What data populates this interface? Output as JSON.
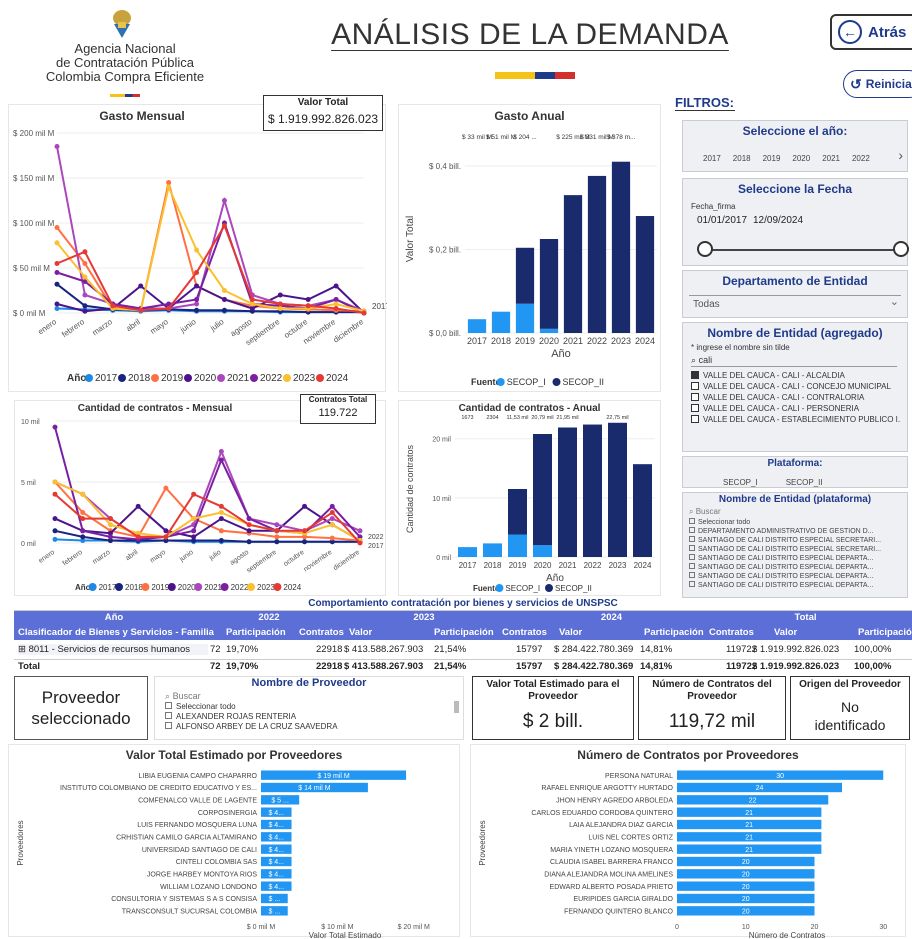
{
  "header": {
    "org_line1": "Agencia Nacional",
    "org_line2": "de Contratación Pública",
    "org_line3": "Colombia Compra Eficiente",
    "title": "ANÁLISIS DE LA DEMANDA",
    "back_label": "Atrás",
    "reset_label": "Reiniciar",
    "flag_colors": [
      "#f3c318",
      "#1f3a8a",
      "#d32f2f"
    ]
  },
  "filters": {
    "label": "FILTROS:",
    "year": {
      "title": "Seleccione el año:",
      "options": [
        "2017",
        "2018",
        "2019",
        "2020",
        "2021",
        "2022"
      ]
    },
    "date": {
      "title": "Seleccione la Fecha",
      "field": "Fecha_firma",
      "start": "01/01/2017",
      "end": "12/09/2024"
    },
    "department": {
      "title": "Departamento de Entidad",
      "value": "Todas"
    },
    "entity": {
      "title": "Nombre de Entidad (agregado)",
      "hint": "* ingrese el nombre sin tilde",
      "search": "cali",
      "items": [
        {
          "label": "VALLE DEL CAUCA - CALI - ALCALDIA",
          "checked": true
        },
        {
          "label": "VALLE DEL CAUCA - CALI - CONCEJO MUNICIPAL",
          "checked": false
        },
        {
          "label": "VALLE DEL CAUCA - CALI - CONTRALORIA",
          "checked": false
        },
        {
          "label": "VALLE DEL CAUCA - CALI - PERSONERIA",
          "checked": false
        },
        {
          "label": "VALLE DEL CAUCA - ESTABLECIMIENTO PUBLICO I...",
          "checked": false
        }
      ]
    },
    "platform": {
      "title": "Plataforma:",
      "options": [
        "SECOP_I",
        "SECOP_II"
      ]
    },
    "entity_platform": {
      "title": "Nombre de Entidad (plataforma)",
      "search_placeholder": "Buscar",
      "items": [
        "Seleccionar todo",
        "DEPARTAMENTO ADMINISTRATIVO DE GESTION D...",
        "SANTIAGO DE CALI DISTRITO ESPECIAL SECRETARI...",
        "SANTIAGO DE CALI DISTRITO ESPECIAL SECRETARI...",
        "SANTIAGO DE CALI DISTRITO ESPECIAL DEPARTA...",
        "SANTIAGO DE CALI DISTRITO ESPECIAL DEPARTA...",
        "SANTIAGO DE CALI DISTRITO ESPECIAL DEPARTA...",
        "SANTIAGO DE CALI DISTRITO ESPECIAL DEPARTA..."
      ]
    }
  },
  "valor_total": {
    "label": "Valor Total",
    "value": "$ 1.919.992.826.023"
  },
  "contratos_total": {
    "label": "Contratos Total",
    "value": "119.722"
  },
  "colors": {
    "2017": "#1e88e5",
    "2018": "#1a237e",
    "2019": "#ff7043",
    "2020": "#4a148c",
    "2021": "#ab47bc",
    "2022": "#7b1fa2",
    "2023": "#fbc02d",
    "2024": "#e53935",
    "secop1": "#2196f3",
    "secop2": "#1a2b6d",
    "hbar": "#2196f3",
    "table_head": "#5b6fd6"
  },
  "chart_data": [
    {
      "type": "line",
      "title": "Gasto Mensual",
      "legend_title": "Año",
      "legend_position": "bottom",
      "categories": [
        "enero",
        "febrero",
        "marzo",
        "abril",
        "mayo",
        "junio",
        "julio",
        "agosto",
        "septiembre",
        "octubre",
        "noviembre",
        "diciembre"
      ],
      "ytick_labels": [
        "$ 0 mil M",
        "$ 50 mil M",
        "$ 100 mil M",
        "$ 150 mil M",
        "$ 200 mil M"
      ],
      "ylim": [
        0,
        200
      ],
      "end_labels": [
        "2017"
      ],
      "series": [
        {
          "name": "2017",
          "values": [
            5,
            4,
            3,
            2,
            3,
            2,
            2,
            2,
            1,
            1,
            1,
            1
          ]
        },
        {
          "name": "2018",
          "values": [
            32,
            8,
            4,
            3,
            4,
            3,
            3,
            2,
            2,
            1,
            1,
            1
          ]
        },
        {
          "name": "2019",
          "values": [
            95,
            55,
            5,
            3,
            145,
            30,
            15,
            8,
            5,
            4,
            3,
            2
          ]
        },
        {
          "name": "2020",
          "values": [
            10,
            2,
            5,
            30,
            5,
            30,
            15,
            5,
            20,
            15,
            30,
            0
          ]
        },
        {
          "name": "2021",
          "values": [
            185,
            20,
            10,
            5,
            5,
            10,
            125,
            20,
            10,
            8,
            15,
            2
          ]
        },
        {
          "name": "2022",
          "values": [
            45,
            35,
            10,
            5,
            10,
            15,
            100,
            10,
            8,
            5,
            15,
            0
          ]
        },
        {
          "name": "2023",
          "values": [
            78,
            40,
            5,
            3,
            140,
            70,
            25,
            10,
            5,
            5,
            10,
            2
          ]
        },
        {
          "name": "2024",
          "values": [
            55,
            68,
            8,
            3,
            5,
            45,
            97,
            15,
            10,
            8,
            5,
            0
          ]
        }
      ]
    },
    {
      "type": "bar",
      "title": "Gasto Anual",
      "xlabel": "Año",
      "ylabel": "Valor Total",
      "legend_title": "Fuente",
      "legend_position": "bottom",
      "categories": [
        "2017",
        "2018",
        "2019",
        "2020",
        "2021",
        "2022",
        "2023",
        "2024"
      ],
      "ytick_labels": [
        "$ 0,0 bill.",
        "$ 0,2 bill.",
        "$ 0,4 bill."
      ],
      "ylim": [
        0,
        0.45
      ],
      "data_labels": [
        "$ 33 mil M",
        "$ 51 mil M",
        "$ 204 ...",
        "",
        "$ 225 mil M",
        "$ 331 mil M",
        "$ 378 m...",
        ""
      ],
      "series": [
        {
          "name": "SECOP_I",
          "values": [
            0.033,
            0.051,
            0.07,
            0.01,
            0,
            0,
            0,
            0
          ]
        },
        {
          "name": "SECOP_II",
          "values": [
            0,
            0,
            0.134,
            0.215,
            0.33,
            0.376,
            0.41,
            0.28
          ]
        }
      ]
    },
    {
      "type": "line",
      "title": "Cantidad de contratos - Mensual",
      "legend_title": "Año",
      "legend_position": "bottom",
      "categories": [
        "enero",
        "febrero",
        "marzo",
        "abril",
        "mayo",
        "junio",
        "julio",
        "agosto",
        "septiembre",
        "octubre",
        "noviembre",
        "diciembre"
      ],
      "ytick_labels": [
        "0 mil",
        "5 mil",
        "10 mil"
      ],
      "ylim": [
        0,
        10
      ],
      "end_labels": [
        "2022",
        "2017"
      ],
      "series": [
        {
          "name": "2017",
          "values": [
            0.3,
            0.2,
            0.2,
            0.1,
            0.2,
            0.1,
            0.1,
            0.1,
            0.1,
            0.1,
            0.1,
            0.1
          ]
        },
        {
          "name": "2018",
          "values": [
            1,
            0.5,
            0.2,
            0.2,
            0.2,
            0.2,
            0.2,
            0.1,
            0.1,
            0.1,
            0.1,
            0.1
          ]
        },
        {
          "name": "2019",
          "values": [
            5,
            2.5,
            1,
            0.5,
            4.5,
            2,
            1,
            0.8,
            0.5,
            0.5,
            0.4,
            0.2
          ]
        },
        {
          "name": "2020",
          "values": [
            2,
            1,
            0.8,
            3,
            1,
            0.5,
            2,
            1,
            1,
            3,
            1.5,
            0.2
          ]
        },
        {
          "name": "2021",
          "values": [
            5,
            4,
            2,
            0.5,
            0.5,
            1.5,
            7.5,
            2,
            1.5,
            1,
            2,
            1
          ]
        },
        {
          "name": "2022",
          "values": [
            9.5,
            1,
            0.5,
            0.3,
            0.5,
            1,
            6.8,
            2,
            1,
            0.8,
            3,
            0.5
          ]
        },
        {
          "name": "2023",
          "values": [
            5,
            4,
            1.5,
            0.8,
            0.5,
            2,
            2.5,
            1.5,
            1,
            0.8,
            1.5,
            0.2
          ]
        },
        {
          "name": "2024",
          "values": [
            4,
            2,
            2,
            0.5,
            0.5,
            4,
            3,
            1.5,
            1,
            1,
            2.5,
            0
          ]
        }
      ]
    },
    {
      "type": "bar",
      "title": "Cantidad de contratos - Anual",
      "xlabel": "Año",
      "ylabel": "Cantidad de contratos",
      "legend_title": "Fuente",
      "legend_position": "bottom",
      "categories": [
        "2017",
        "2018",
        "2019",
        "2020",
        "2021",
        "2022",
        "2023",
        "2024"
      ],
      "ytick_labels": [
        "0 mil",
        "10 mil",
        "20 mil"
      ],
      "ylim": [
        0,
        23
      ],
      "data_labels": [
        "1673",
        "2304",
        "11,53 mil",
        "20,79 mil",
        "21,95 mil",
        "",
        "22,75 mil",
        ""
      ],
      "series": [
        {
          "name": "SECOP_I",
          "values": [
            1.67,
            2.3,
            3.8,
            2,
            0,
            0,
            0,
            0
          ]
        },
        {
          "name": "SECOP_II",
          "values": [
            0,
            0,
            7.7,
            18.8,
            21.9,
            22.4,
            22.7,
            15.7
          ]
        }
      ]
    },
    {
      "type": "bar",
      "orientation": "horizontal",
      "title": "Valor Total Estimado por Proveedores",
      "xlabel": "Valor Total Estimado",
      "ylabel": "Proveedores",
      "xtick_labels": [
        "$ 0 mil M",
        "$ 10 mil M",
        "$ 20 mil M"
      ],
      "xlim": [
        0,
        22
      ],
      "categories": [
        "LIBIA EUGENIA CAMPO CHAPARRO",
        "INSTITUTO COLOMBIANO DE CREDITO EDUCATIVO Y ES...",
        "COMFENALCO VALLE DE LAGENTE",
        "CORPOSINERGIA",
        "LUIS FERNANDO MOSQUERA LUNA",
        "CRHISTIAN CAMILO GARCIA ALTAMIRANO",
        "UNIVERSIDAD SANTIAGO DE CALI",
        "CINTELI COLOMBIA SAS",
        "JORGE HARBEY MONTOYA RIOS",
        "WILLIAM LOZANO LONDONO",
        "CONSULTORIA Y SISTEMAS S A S CONSISA",
        "TRANSCONSULT SUCURSAL COLOMBIA"
      ],
      "values": [
        19,
        14,
        5,
        4,
        4,
        4,
        4,
        4,
        4,
        4,
        3.5,
        3.5
      ],
      "data_labels": [
        "$ 19 mil M",
        "$ 14 mil M",
        "$ 5 ...",
        "$ 4...",
        "$ 4...",
        "$ 4...",
        "$ 4...",
        "$ 4...",
        "$ 4...",
        "$ 4...",
        "$ ...",
        "$ ..."
      ]
    },
    {
      "type": "bar",
      "orientation": "horizontal",
      "title": "Número de Contratos por Proveedores",
      "xlabel": "Número de Contratos",
      "ylabel": "Proveedores",
      "xtick_labels": [
        "0",
        "10",
        "20",
        "30"
      ],
      "xlim": [
        0,
        32
      ],
      "categories": [
        "PERSONA NATURAL",
        "RAFAEL ENRIQUE ARGOTTY HURTADO",
        "JHON HENRY AGREDO ARBOLEDA",
        "CARLOS EDUARDO CORDOBA QUINTERO",
        "LAIA ALEJANDRA DIAZ GARCIA",
        "LUIS NEL CORTES ORTIZ",
        "MARIA YINETH LOZANO MOSQUERA",
        "CLAUDIA ISABEL BARRERA FRANCO",
        "DIANA ALEJANDRA MOLINA AMELINES",
        "EDWARD ALBERTO POSADA PRIETO",
        "EURIPIDES GARCIA GIRALDO",
        "FERNANDO QUINTERO BLANCO"
      ],
      "values": [
        30,
        24,
        22,
        21,
        21,
        21,
        21,
        20,
        20,
        20,
        20,
        20
      ],
      "data_labels": [
        "30",
        "24",
        "22",
        "21",
        "21",
        "21",
        "21",
        "20",
        "20",
        "20",
        "20",
        "20"
      ]
    }
  ],
  "table": {
    "title": "Comportamiento contratación por bienes y servicios de UNSPSC",
    "year_headers": [
      "Año",
      "2022",
      "2023",
      "2024",
      "Total"
    ],
    "col_headers": [
      "Clasificador de Bienes y Servicios - Familia",
      "Participación",
      "Contratos",
      "Valor",
      "Participación",
      "Contratos",
      "Valor",
      "Participación",
      "Contratos",
      "Valor",
      "Participación"
    ],
    "rows": [
      {
        "label": "8011 - Servicios de recursos humanos",
        "cells": [
          "72",
          "19,70%",
          "22918",
          "$ 413.588.267.903",
          "21,54%",
          "15797",
          "$ 284.422.780.369",
          "14,81%",
          "119722",
          "$ 1.919.992.826.023",
          "100,00%"
        ]
      },
      {
        "label": "Total",
        "cells": [
          "72",
          "19,70%",
          "22918",
          "$ 413.588.267.903",
          "21,54%",
          "15797",
          "$ 284.422.780.369",
          "14,81%",
          "119722",
          "$ 1.919.992.826.023",
          "100,00%"
        ]
      }
    ]
  },
  "proveedor": {
    "selected_label": "Proveedor seleccionado",
    "slicer_title": "Nombre de Proveedor",
    "search_placeholder": "Buscar",
    "items": [
      "Seleccionar todo",
      "ALEXANDER ROJAS RENTERIA",
      "ALFONSO ARBEY DE LA CRUZ SAAVEDRA"
    ]
  },
  "kpis": {
    "valor_title": "Valor Total Estimado para el Proveedor",
    "valor": "$ 2 bill.",
    "contratos_title": "Número de Contratos del Proveedor",
    "contratos": "119,72 mil",
    "origen_title": "Origen del Proveedor",
    "origen": "No identificado"
  }
}
